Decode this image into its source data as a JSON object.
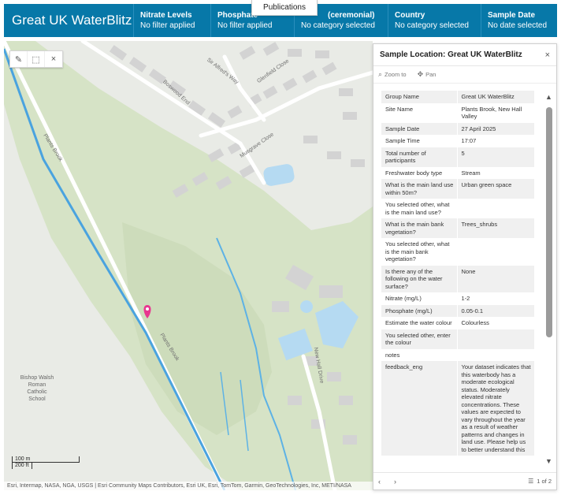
{
  "header": {
    "brand": "Great UK WaterBlitz",
    "filters": [
      {
        "label": "Nitrate Levels",
        "value": "No filter applied"
      },
      {
        "label": "Phosphate",
        "value": "No filter applied"
      },
      {
        "label": "(ceremonial)",
        "value": "No category selected"
      },
      {
        "label": "Country",
        "value": "No category selected"
      },
      {
        "label": "Sample Date",
        "value": "No date selected"
      }
    ]
  },
  "menu_popup": {
    "label": "Publications"
  },
  "map": {
    "tools": [
      "edit-icon",
      "select-icon",
      "close-icon"
    ],
    "roads": [
      "Sir Alfred's Way",
      "Glenfield Close",
      "Boswood End",
      "Musgrave Close",
      "Plants Brook",
      "New Hall Drive"
    ],
    "school": "Bishop Walsh Roman Catholic School",
    "scale": {
      "metric": "100 m",
      "imperial": "200 ft"
    },
    "attribution": "Esri, Intermap, NASA, NGA, USGS | Esri Community Maps Contributors, Esri UK, Esri, TomTom, Garmin, GeoTechnologies, Inc, METI/NASA"
  },
  "popup": {
    "title": "Sample Location: Great UK WaterBlitz",
    "close": "×",
    "actions": {
      "zoom": "Zoom to",
      "pan": "Pan"
    },
    "attributes": [
      {
        "k": "Group Name",
        "v": "Great UK WaterBlitz"
      },
      {
        "k": "Site Name",
        "v": "Plants Brook, New Hall Valley"
      },
      {
        "k": "Sample Date",
        "v": "27 April 2025"
      },
      {
        "k": "Sample Time",
        "v": "17:07"
      },
      {
        "k": "Total number of participants",
        "v": "5"
      },
      {
        "k": "Freshwater body type",
        "v": "Stream"
      },
      {
        "k": "What is the main land use within 50m?",
        "v": "Urban green space"
      },
      {
        "k": "You selected other, what is the main land use?",
        "v": ""
      },
      {
        "k": "What is the main bank vegetation?",
        "v": "Trees_shrubs"
      },
      {
        "k": "You selected other, what is the main bank vegetation?",
        "v": ""
      },
      {
        "k": "Is there any of the following on the water surface?",
        "v": "None"
      },
      {
        "k": "Nitrate (mg/L)",
        "v": "1-2"
      },
      {
        "k": "Phosphate (mg/L)",
        "v": "0.05-0.1"
      },
      {
        "k": "Estimate the water colour",
        "v": "Colourless"
      },
      {
        "k": "You selected other, enter the colour",
        "v": ""
      },
      {
        "k": "notes",
        "v": ""
      },
      {
        "k": "feedback_eng",
        "v": "Your dataset indicates that this waterbody has a moderate ecological status. Moderately elevated nitrate concentrations. These values are expected to vary throughout the year as a result of weather patterns and changes in land use. Please help us to better understand this"
      }
    ],
    "pager": "1 of 2"
  },
  "colors": {
    "header": "#0778a8",
    "stream": "#4aa3df",
    "pin": "#e8368f"
  }
}
